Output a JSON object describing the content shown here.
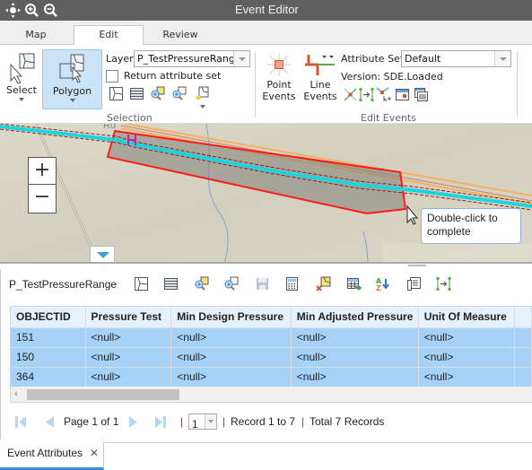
{
  "window": {
    "title": "Event Editor",
    "title_icons": [
      "pan-icon",
      "zoom-in-icon",
      "zoom-out-icon"
    ]
  },
  "tabs": [
    {
      "label": "Map",
      "active": false
    },
    {
      "label": "Edit",
      "active": true
    },
    {
      "label": "Review",
      "active": false
    }
  ],
  "ribbon": {
    "selection": {
      "group_label": "Selection",
      "select_label": "Select",
      "polygon_label": "Polygon",
      "layer_label": "Layer:",
      "layer_value": "P_TestPressureRange",
      "return_attr_label": "Return attribute set",
      "return_attr_checked": false
    },
    "edit_events": {
      "group_label": "Edit Events",
      "point_events_line1": "Point",
      "point_events_line2": "Events",
      "line_events_line1": "Line",
      "line_events_line2": "Events",
      "attribute_set_label": "Attribute Set:",
      "attribute_set_value": "Default",
      "version_text": "Version: SDE.Loaded"
    }
  },
  "map": {
    "zoom_in": "+",
    "zoom_out": "−",
    "road_label": "Rd",
    "tooltip_line1": "Double-click to",
    "tooltip_line2": "complete",
    "colors": {
      "polygon_stroke": "#ff0000",
      "route_line": "#17d6e0",
      "pipeline": "#f5b060",
      "basemap": "#d7d4c4"
    }
  },
  "attribute_panel": {
    "layer_name": "P_TestPressureRange",
    "toolbar_icons": [
      "select-features-icon",
      "show-table-icon",
      "zoom-to-selected-icon",
      "zoom-to-all-icon",
      "save-icon",
      "calculator-icon",
      "clear-selection-icon",
      "export-table-icon",
      "sort-icon",
      "options-icon",
      "measure-range-icon"
    ],
    "columns": [
      "OBJECTID",
      "Pressure Test",
      "Min Design Pressure",
      "Min Adjusted Pressure",
      "Unit Of Measure"
    ],
    "rows": [
      [
        "151",
        "<null>",
        "<null>",
        "<null>",
        "<null>"
      ],
      [
        "150",
        "<null>",
        "<null>",
        "<null>",
        "<null>"
      ],
      [
        "364",
        "<null>",
        "<null>",
        "<null>",
        "<null>"
      ]
    ]
  },
  "pager": {
    "page_text": "Page 1 of 1",
    "page_select": "1",
    "sep": "|",
    "record_text": "Record 1 to 7",
    "total_text": "Total 7 Records"
  },
  "bottom_tabs": [
    {
      "label": "Event Attributes",
      "close": "✕"
    }
  ]
}
